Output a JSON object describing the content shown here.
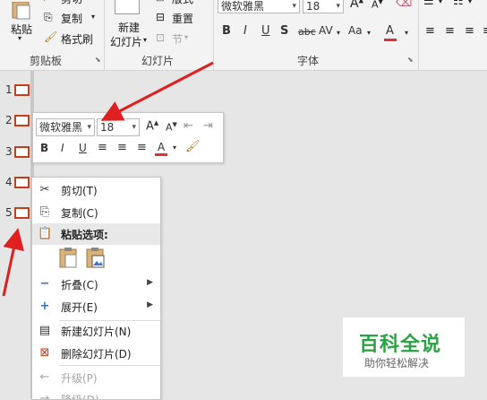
{
  "ribbon": {
    "clipboard": {
      "paste_label": "粘贴",
      "cut_label": "剪切",
      "copy_label": "复制",
      "format_painter_label": "格式刷",
      "group_label": "剪贴板"
    },
    "slides": {
      "new_slide_line1": "新建",
      "new_slide_line2": "幻灯片",
      "layout_label": "版式",
      "reset_label": "重置",
      "section_label": "节",
      "group_label": "幻灯片"
    },
    "font": {
      "font_name": "微软雅黑",
      "font_size": "18",
      "group_label": "字体",
      "bold": "B",
      "italic": "I",
      "underline": "U",
      "shadow": "S",
      "strike": "abc",
      "spacing": "AV",
      "case": "Aa",
      "color_letter": "A"
    },
    "colors": {
      "accent": "#c43e1c",
      "font_color": "#e03030"
    }
  },
  "slide_panel": {
    "slides": [
      "1",
      "2",
      "3",
      "4",
      "5"
    ]
  },
  "mini_toolbar": {
    "font_name": "微软雅黑",
    "font_size": "18",
    "bold": "B",
    "italic": "I",
    "underline": "U",
    "color_letter": "A"
  },
  "context_menu": {
    "cut": "剪切(T)",
    "copy": "复制(C)",
    "paste_options": "粘贴选项:",
    "collapse": "折叠(C)",
    "expand": "展开(E)",
    "new_slide": "新建幻灯片(N)",
    "delete_slide": "删除幻灯片(D)",
    "promote": "升级(P)",
    "demote": "降级(D)"
  },
  "watermark": {
    "title": "百科全说",
    "subtitle": "助你轻松解决",
    "title_color": "#2ba245"
  }
}
